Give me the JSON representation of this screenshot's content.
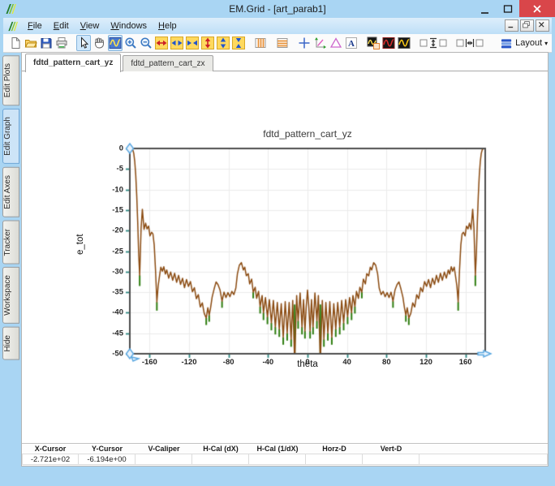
{
  "window": {
    "title": "EM.Grid - [art_parab1]"
  },
  "menu": {
    "items": [
      {
        "label": "File"
      },
      {
        "label": "Edit"
      },
      {
        "label": "View"
      },
      {
        "label": "Windows"
      },
      {
        "label": "Help"
      }
    ]
  },
  "toolbar": {
    "layout_label": "Layout",
    "layout_caret": "▾",
    "buttons": [
      {
        "name": "new-file"
      },
      {
        "name": "open-file"
      },
      {
        "name": "save-file"
      },
      {
        "name": "print"
      },
      {
        "sep": true
      },
      {
        "name": "pointer-tool",
        "selected": true
      },
      {
        "name": "pan-tool"
      },
      {
        "name": "trace-select-tool",
        "selected": true
      },
      {
        "name": "zoom-in-tool"
      },
      {
        "name": "zoom-out-tool"
      },
      {
        "name": "expand-x-axis"
      },
      {
        "name": "stretch-x-axis"
      },
      {
        "name": "shrink-x-axis"
      },
      {
        "name": "expand-y-axis"
      },
      {
        "name": "stretch-y-axis"
      },
      {
        "name": "shrink-y-axis"
      },
      {
        "sep": true
      },
      {
        "name": "vertical-grid"
      },
      {
        "sep": true
      },
      {
        "name": "horizontal-grid"
      },
      {
        "sep": true
      },
      {
        "name": "crosshair-marker"
      },
      {
        "name": "axes-marker"
      },
      {
        "name": "delta-marker"
      },
      {
        "name": "text-annotation"
      },
      {
        "sep": true
      },
      {
        "name": "plot-window"
      },
      {
        "name": "plot-dark-red"
      },
      {
        "name": "plot-dark-yellow"
      },
      {
        "sep": true
      },
      {
        "name": "fit-height-group",
        "wide": true
      },
      {
        "sep": true
      },
      {
        "name": "fit-width-group",
        "wide": true
      }
    ]
  },
  "tabs": [
    {
      "label": "fdtd_pattern_cart_yz",
      "active": true
    },
    {
      "label": "fdtd_pattern_cart_zx",
      "active": false
    }
  ],
  "sidebar": {
    "tabs": [
      {
        "label": "Edit Plots"
      },
      {
        "label": "Edit Graph",
        "active": true
      },
      {
        "label": "Edit Axes"
      },
      {
        "label": "Tracker"
      },
      {
        "label": "Workspace"
      },
      {
        "label": "Hide"
      }
    ]
  },
  "statusbar": {
    "columns": [
      {
        "header": "X-Cursor",
        "value": "-2.721e+02"
      },
      {
        "header": "Y-Cursor",
        "value": "-6.194e+00"
      },
      {
        "header": "V-Caliper",
        "value": ""
      },
      {
        "header": "H-Cal (dX)",
        "value": ""
      },
      {
        "header": "H-Cal (1/dX)",
        "value": ""
      },
      {
        "header": "Horz-D",
        "value": ""
      },
      {
        "header": "Vert-D",
        "value": ""
      }
    ]
  },
  "chart_data": {
    "type": "line",
    "title": "fdtd_pattern_cart_yz",
    "xlabel": "theta",
    "ylabel": "e_tot",
    "xlim": [
      -180,
      180
    ],
    "ylim": [
      -50,
      0
    ],
    "xticks": [
      -160,
      -120,
      -80,
      -40,
      0,
      40,
      80,
      120,
      160
    ],
    "yticks": [
      0,
      -5,
      -10,
      -15,
      -20,
      -25,
      -30,
      -35,
      -40,
      -45,
      -50
    ],
    "grid": true,
    "grid_color": "#ebebeb",
    "frame_color": "#4d4d4d",
    "tick_color": "#2a8680",
    "cursor_color": "#58a6e0",
    "series": [
      {
        "name": "e_tot",
        "color": "#8a4a10",
        "points": [
          [
            -180,
            0
          ],
          [
            -178,
            -0.1
          ],
          [
            -177,
            -0.3
          ],
          [
            -176,
            -1.2
          ],
          [
            -175,
            -3.2
          ],
          [
            -174,
            -6.5
          ],
          [
            -173,
            -11.5
          ],
          [
            -172,
            -18
          ],
          [
            -171,
            -26
          ],
          [
            -170,
            -30.9
          ],
          [
            -168.6,
            -19.5
          ],
          [
            -167.3,
            -14.8
          ],
          [
            -165.6,
            -19.7
          ],
          [
            -164,
            -18.2
          ],
          [
            -162.6,
            -19.6
          ],
          [
            -161,
            -18.9
          ],
          [
            -159.6,
            -21.3
          ],
          [
            -158,
            -20.4
          ],
          [
            -156.6,
            -20.8
          ],
          [
            -155.3,
            -23.5
          ],
          [
            -154,
            -29.5
          ],
          [
            -152.6,
            -37.4
          ],
          [
            -151.3,
            -33.5
          ],
          [
            -150,
            -31.2
          ],
          [
            -148.6,
            -28.9
          ],
          [
            -147,
            -29.9
          ],
          [
            -145.6,
            -28.8
          ],
          [
            -144,
            -30.6
          ],
          [
            -142.6,
            -29.6
          ],
          [
            -140.6,
            -31.6
          ],
          [
            -138.6,
            -30.1
          ],
          [
            -136.6,
            -32.1
          ],
          [
            -134.6,
            -30.4
          ],
          [
            -132.6,
            -32.6
          ],
          [
            -130.6,
            -30.9
          ],
          [
            -128.6,
            -33.1
          ],
          [
            -126.6,
            -31.6
          ],
          [
            -124.6,
            -33.9
          ],
          [
            -122.6,
            -31.9
          ],
          [
            -120.6,
            -33.6
          ],
          [
            -118.6,
            -32.4
          ],
          [
            -116.6,
            -34.9
          ],
          [
            -114.6,
            -33.9
          ],
          [
            -112.6,
            -36.6
          ],
          [
            -110.6,
            -35.6
          ],
          [
            -108.6,
            -38.6
          ],
          [
            -106.6,
            -37.6
          ],
          [
            -104.6,
            -40.2
          ],
          [
            -102.6,
            -41.3
          ],
          [
            -101,
            -38.8
          ],
          [
            -99.6,
            -40.6
          ],
          [
            -98.2,
            -38.8
          ],
          [
            -96.6,
            -36.2
          ],
          [
            -94.6,
            -34.2
          ],
          [
            -92.6,
            -32.5
          ],
          [
            -90.6,
            -33.2
          ],
          [
            -88.6,
            -34.5
          ],
          [
            -86.6,
            -37.2
          ],
          [
            -84.6,
            -35
          ],
          [
            -82.6,
            -36.3
          ],
          [
            -80.6,
            -35.1
          ],
          [
            -78.6,
            -36.1
          ],
          [
            -76.6,
            -34.8
          ],
          [
            -74.6,
            -35.6
          ],
          [
            -72.6,
            -34
          ],
          [
            -71,
            -30.5
          ],
          [
            -69,
            -28.4
          ],
          [
            -67,
            -27.8
          ],
          [
            -65,
            -29.6
          ],
          [
            -63.6,
            -28.9
          ],
          [
            -62,
            -31
          ],
          [
            -60,
            -30.5
          ],
          [
            -58.6,
            -33
          ],
          [
            -56.6,
            -31.8
          ],
          [
            -55,
            -35
          ],
          [
            -53,
            -33.8
          ],
          [
            -51.6,
            -36.5
          ],
          [
            -49.6,
            -34.8
          ],
          [
            -48,
            -38.5
          ],
          [
            -46,
            -35.8
          ],
          [
            -44.6,
            -40
          ],
          [
            -42.6,
            -36.3
          ],
          [
            -40.6,
            -41
          ],
          [
            -38.6,
            -36.8
          ],
          [
            -36.6,
            -42.5
          ],
          [
            -34.6,
            -37
          ],
          [
            -32.6,
            -43.5
          ],
          [
            -30.6,
            -37.5
          ],
          [
            -28.6,
            -44
          ],
          [
            -26.6,
            -37.8
          ],
          [
            -24.6,
            -46
          ],
          [
            -22.6,
            -37.3
          ],
          [
            -20.6,
            -45
          ],
          [
            -18.6,
            -37.5
          ],
          [
            -16.6,
            -46.5
          ],
          [
            -15,
            -37
          ],
          [
            -13,
            -52
          ],
          [
            -11,
            -35.8
          ],
          [
            -9.5,
            -42
          ],
          [
            -7.5,
            -35.2
          ],
          [
            -5.6,
            -43.5
          ],
          [
            -4,
            -36.8
          ],
          [
            -2.6,
            -44.5
          ],
          [
            -1.3,
            -38.5
          ],
          [
            0,
            -34.5
          ],
          [
            1.3,
            -38.5
          ],
          [
            2.6,
            -44.5
          ],
          [
            4,
            -36.8
          ],
          [
            5.6,
            -43.5
          ],
          [
            7.5,
            -35.2
          ],
          [
            9.5,
            -42
          ],
          [
            11,
            -35.8
          ],
          [
            13,
            -52
          ],
          [
            15,
            -37
          ],
          [
            16.6,
            -46.5
          ],
          [
            18.6,
            -37.5
          ],
          [
            20.6,
            -45
          ],
          [
            22.6,
            -37.3
          ],
          [
            24.6,
            -46
          ],
          [
            26.6,
            -37.8
          ],
          [
            28.6,
            -44
          ],
          [
            30.6,
            -37.5
          ],
          [
            32.6,
            -43.5
          ],
          [
            34.6,
            -37
          ],
          [
            36.6,
            -42.5
          ],
          [
            38.6,
            -36.8
          ],
          [
            40.6,
            -41
          ],
          [
            42.6,
            -36.3
          ],
          [
            44.6,
            -40
          ],
          [
            46,
            -35.8
          ],
          [
            48,
            -38.5
          ],
          [
            49.6,
            -34.8
          ],
          [
            51.6,
            -36.5
          ],
          [
            53,
            -33.8
          ],
          [
            55,
            -35
          ],
          [
            56.6,
            -31.8
          ],
          [
            58.6,
            -33
          ],
          [
            60,
            -30.5
          ],
          [
            62,
            -31
          ],
          [
            63.6,
            -28.9
          ],
          [
            65,
            -29.6
          ],
          [
            67,
            -27.8
          ],
          [
            69,
            -28.4
          ],
          [
            71,
            -30.5
          ],
          [
            72.6,
            -34
          ],
          [
            74.6,
            -35.6
          ],
          [
            76.6,
            -34.8
          ],
          [
            78.6,
            -36.1
          ],
          [
            80.6,
            -35.1
          ],
          [
            82.6,
            -36.3
          ],
          [
            84.6,
            -35
          ],
          [
            86.6,
            -37.2
          ],
          [
            88.6,
            -34.5
          ],
          [
            90.6,
            -33.2
          ],
          [
            92.6,
            -32.5
          ],
          [
            94.6,
            -34.2
          ],
          [
            96.6,
            -36.2
          ],
          [
            98.2,
            -38.8
          ],
          [
            99.6,
            -40.6
          ],
          [
            101,
            -38.8
          ],
          [
            102.6,
            -41.3
          ],
          [
            104.6,
            -40.2
          ],
          [
            106.6,
            -37.6
          ],
          [
            108.6,
            -38.6
          ],
          [
            110.6,
            -35.6
          ],
          [
            112.6,
            -36.6
          ],
          [
            114.6,
            -33.9
          ],
          [
            116.6,
            -34.9
          ],
          [
            118.6,
            -32.4
          ],
          [
            120.6,
            -33.6
          ],
          [
            122.6,
            -31.9
          ],
          [
            124.6,
            -33.9
          ],
          [
            126.6,
            -31.6
          ],
          [
            128.6,
            -33.1
          ],
          [
            130.6,
            -30.9
          ],
          [
            132.6,
            -32.6
          ],
          [
            134.6,
            -30.4
          ],
          [
            136.6,
            -32.1
          ],
          [
            138.6,
            -30.1
          ],
          [
            140.6,
            -31.6
          ],
          [
            142.6,
            -29.6
          ],
          [
            144,
            -30.6
          ],
          [
            145.6,
            -28.8
          ],
          [
            147,
            -29.9
          ],
          [
            148.6,
            -28.9
          ],
          [
            150,
            -31.2
          ],
          [
            151.3,
            -33.5
          ],
          [
            152.6,
            -37.4
          ],
          [
            154,
            -29.5
          ],
          [
            155.3,
            -23.5
          ],
          [
            156.6,
            -20.8
          ],
          [
            158,
            -20.4
          ],
          [
            159.6,
            -21.3
          ],
          [
            161,
            -18.9
          ],
          [
            162.6,
            -19.6
          ],
          [
            164,
            -18.2
          ],
          [
            165.6,
            -19.7
          ],
          [
            167.3,
            -14.8
          ],
          [
            168.6,
            -19.5
          ],
          [
            170,
            -30.9
          ],
          [
            171,
            -26
          ],
          [
            172,
            -18
          ],
          [
            173,
            -11.5
          ],
          [
            174,
            -6.5
          ],
          [
            175,
            -3.2
          ],
          [
            176,
            -1.2
          ],
          [
            177,
            -0.3
          ],
          [
            178,
            -0.1
          ],
          [
            180,
            0
          ]
        ]
      }
    ],
    "null_spikes": {
      "name": "under-trace green null spikes",
      "color": "#2e7d0f",
      "spikes": [
        [
          -170,
          -30.9,
          -33.5
        ],
        [
          -152.6,
          -37.4,
          -39.5
        ],
        [
          -102.6,
          -41.3,
          -43
        ],
        [
          -99.6,
          -40.6,
          -42.2
        ],
        [
          -86.6,
          -37.2,
          -38.8
        ],
        [
          -55,
          -35,
          -36.5
        ],
        [
          -48,
          -38.5,
          -40.2
        ],
        [
          -44.6,
          -40,
          -41.8
        ],
        [
          -40.6,
          -41,
          -42.8
        ],
        [
          -36.6,
          -42.5,
          -44.3
        ],
        [
          -32.6,
          -43.5,
          -45.3
        ],
        [
          -28.6,
          -44,
          -45.9
        ],
        [
          -24.6,
          -46,
          -47.8
        ],
        [
          -20.6,
          -45,
          -46.8
        ],
        [
          -16.6,
          -46.5,
          -48.3
        ],
        [
          -13,
          -38,
          -52
        ],
        [
          -9.5,
          -42,
          -43.9
        ],
        [
          -5.6,
          -43.5,
          -45.3
        ],
        [
          -2.6,
          -44.5,
          -46.3
        ],
        [
          2.6,
          -44.5,
          -46.3
        ],
        [
          5.6,
          -43.5,
          -45.3
        ],
        [
          9.5,
          -42,
          -43.9
        ],
        [
          13,
          -38,
          -52
        ],
        [
          16.6,
          -46.5,
          -48.3
        ],
        [
          20.6,
          -45,
          -46.8
        ],
        [
          24.6,
          -46,
          -47.8
        ],
        [
          28.6,
          -44,
          -45.9
        ],
        [
          32.6,
          -43.5,
          -45.3
        ],
        [
          36.6,
          -42.5,
          -44.3
        ],
        [
          40.6,
          -41,
          -42.8
        ],
        [
          44.6,
          -40,
          -41.8
        ],
        [
          48,
          -38.5,
          -40.2
        ],
        [
          55,
          -35,
          -36.5
        ],
        [
          86.6,
          -37.2,
          -38.8
        ],
        [
          99.6,
          -40.6,
          -42.2
        ],
        [
          102.6,
          -41.3,
          -43
        ],
        [
          152.6,
          -37.4,
          -39.5
        ],
        [
          170,
          -30.9,
          -33.5
        ]
      ]
    },
    "cursor_markers": [
      {
        "x": -180,
        "y": 0,
        "shape": "diamond"
      },
      {
        "x": -180,
        "y": -50,
        "shape": "diamond-arrow"
      },
      {
        "x": 180,
        "y": -50,
        "shape": "arrow-right"
      }
    ]
  }
}
